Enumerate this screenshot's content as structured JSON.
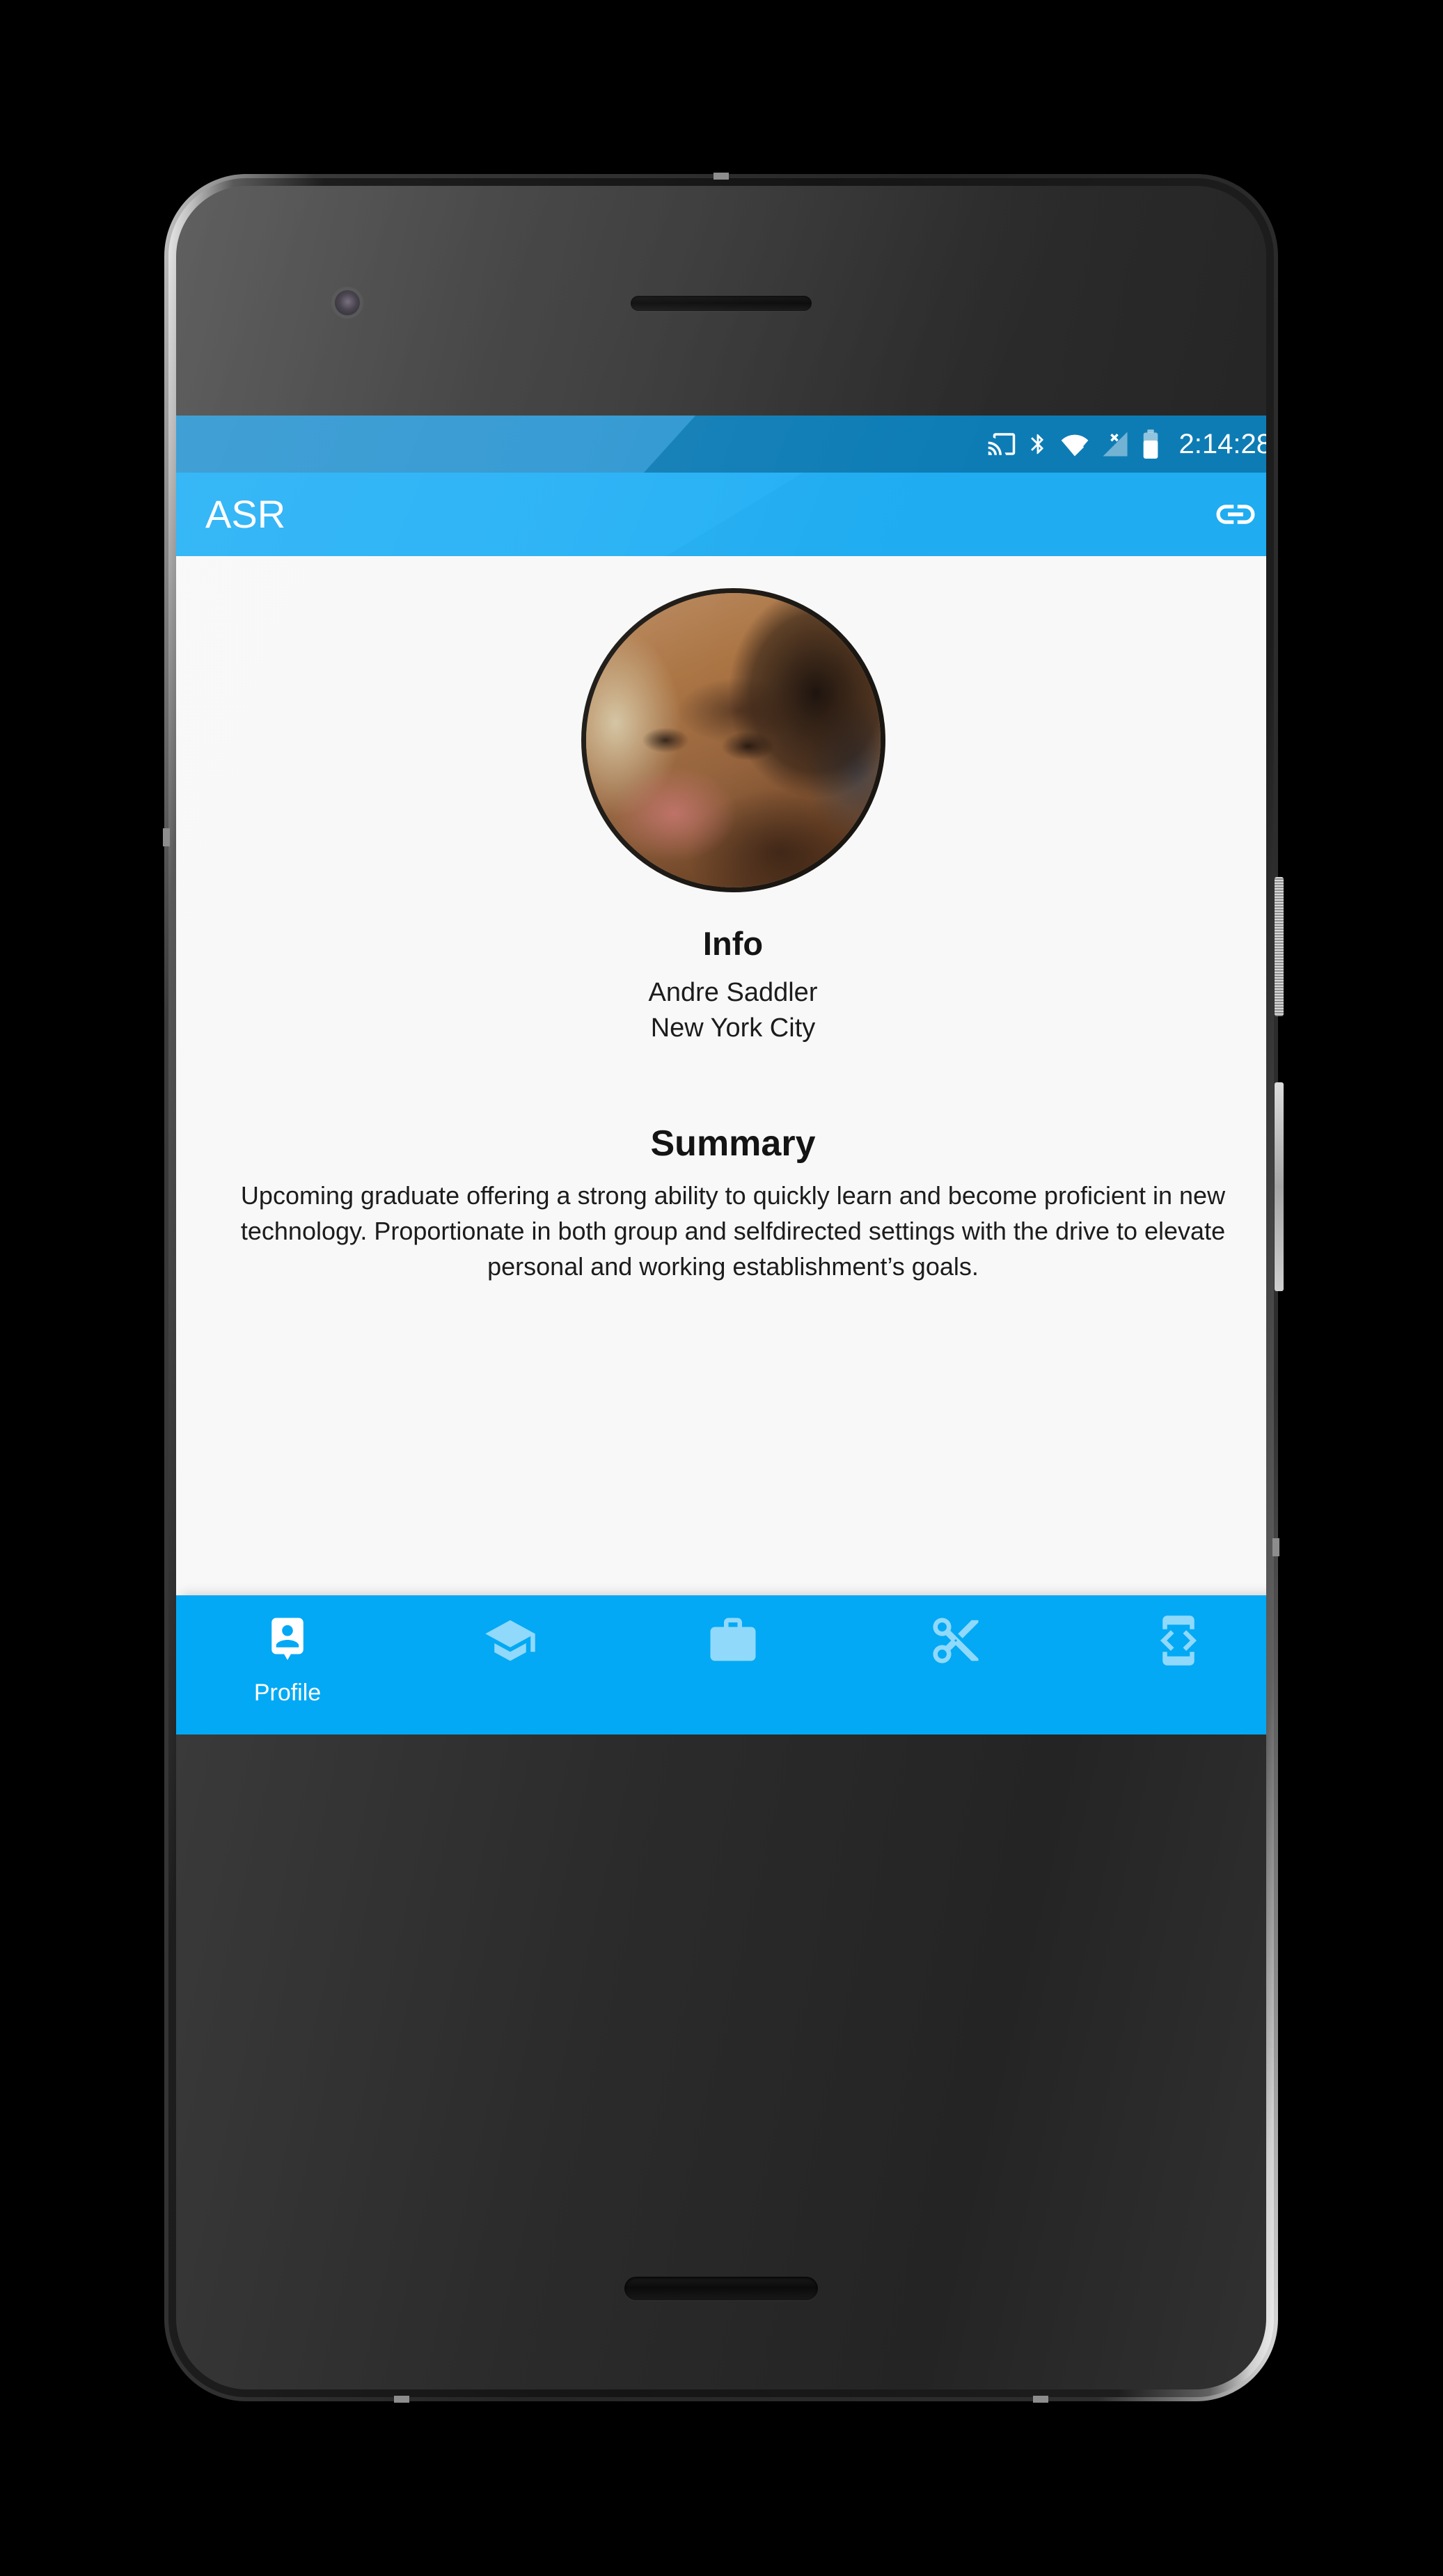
{
  "status_bar": {
    "time": "2:14:28",
    "icons": [
      {
        "name": "cast-icon",
        "label": "Cast"
      },
      {
        "name": "bluetooth-icon",
        "label": "Bluetooth"
      },
      {
        "name": "wifi-icon",
        "label": "Wi-Fi"
      },
      {
        "name": "cellular-signal-off-icon",
        "label": "No cellular signal"
      },
      {
        "name": "battery-icon",
        "label": "Battery"
      }
    ],
    "background_color": "#2d96d1",
    "tint_color": "#0d7cb5",
    "text_color": "#ffffff"
  },
  "app_bar": {
    "title": "ASR",
    "action": {
      "name": "link-icon",
      "label": "Link"
    },
    "background_color": "#23b0f5",
    "text_color": "#ffffff"
  },
  "content": {
    "avatar": {
      "name": "profile-avatar",
      "alt": "Profile photo"
    },
    "info": {
      "heading": "Info",
      "name": "Andre Saddler",
      "location": "New York City"
    },
    "summary": {
      "heading": "Summary",
      "body": "Upcoming graduate offering a strong ability to quickly learn and become proficient in new technology. Proportionate in both group and selfdirected settings with the drive to elevate personal and working establishment’s goals."
    },
    "background_color": "#f8f8f8"
  },
  "bottom_nav": {
    "background_color": "#03a9f4",
    "active_index": 0,
    "items": [
      {
        "icon": "account-box-icon",
        "label": "Profile",
        "active": true
      },
      {
        "icon": "graduation-cap-icon",
        "label": "",
        "active": false
      },
      {
        "icon": "briefcase-icon",
        "label": "",
        "active": false
      },
      {
        "icon": "scissors-icon",
        "label": "",
        "active": false
      },
      {
        "icon": "developer-mode-icon",
        "label": "",
        "active": false
      }
    ]
  }
}
